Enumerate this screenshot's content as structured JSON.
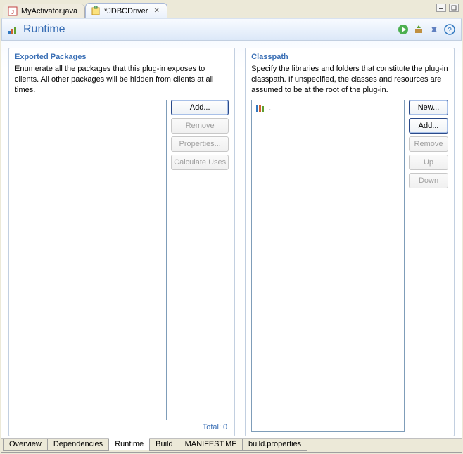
{
  "topTabs": [
    {
      "label": "MyActivator.java",
      "active": false,
      "icon": "java-file"
    },
    {
      "label": "*JDBCDriver",
      "active": true,
      "icon": "plugin-file"
    }
  ],
  "header": {
    "title": "Runtime",
    "actions": {
      "run": "run-icon",
      "export": "export-icon",
      "debug": "debug-icon",
      "help": "help-icon"
    }
  },
  "exported": {
    "title": "Exported Packages",
    "description": "Enumerate all the packages that this plug-in exposes to clients. All other packages will be hidden from clients at all times.",
    "buttons": {
      "add": "Add...",
      "remove": "Remove",
      "properties": "Properties...",
      "calc": "Calculate Uses"
    },
    "totalLabel": "Total: 0"
  },
  "classpath": {
    "title": "Classpath",
    "description": "Specify the libraries and folders that constitute the plug-in classpath.  If unspecified, the classes and resources are assumed to be at the root of the plug-in.",
    "items": [
      {
        "label": "."
      }
    ],
    "buttons": {
      "new": "New...",
      "add": "Add...",
      "remove": "Remove",
      "up": "Up",
      "down": "Down"
    }
  },
  "bottomTabs": {
    "overview": "Overview",
    "dependencies": "Dependencies",
    "runtime": "Runtime",
    "build": "Build",
    "manifest": "MANIFEST.MF",
    "buildprops": "build.properties"
  }
}
